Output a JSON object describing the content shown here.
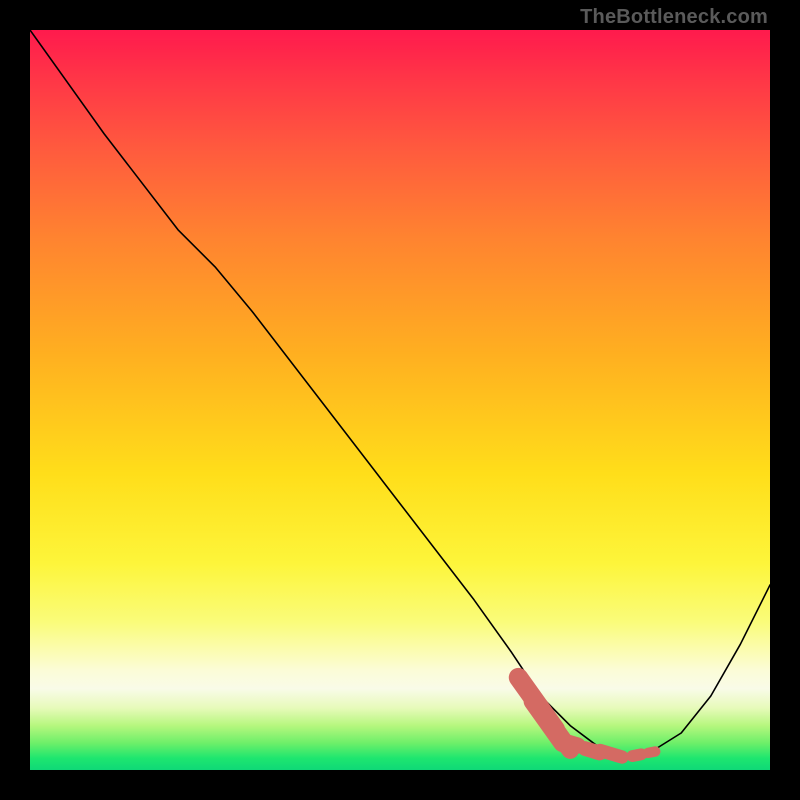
{
  "brand": "TheBottleneck.com",
  "chart_data": {
    "type": "line",
    "title": "",
    "xlabel": "",
    "ylabel": "",
    "xlim": [
      0,
      100
    ],
    "ylim": [
      0,
      100
    ],
    "grid": false,
    "legend": false,
    "series": [
      {
        "name": "bottleneck-curve",
        "x": [
          0,
          10,
          20,
          25,
          30,
          40,
          50,
          60,
          65,
          69,
          73,
          77,
          81,
          84,
          88,
          92,
          96,
          100
        ],
        "y": [
          100,
          86,
          73,
          68,
          62,
          49,
          36,
          23,
          16,
          10,
          6,
          3,
          2,
          2.5,
          5,
          10,
          17,
          25
        ]
      }
    ],
    "markers": {
      "name": "highlight-dashes",
      "points": [
        {
          "x": 68.5,
          "y": 9.0,
          "len": 5.0,
          "w": 2.6
        },
        {
          "x": 70.0,
          "y": 6.5,
          "len": 4.0,
          "w": 2.6
        },
        {
          "x": 71.5,
          "y": 4.8,
          "len": 3.0,
          "w": 2.4
        },
        {
          "x": 73.0,
          "y": 3.6,
          "len": 2.0,
          "w": 2.2
        },
        {
          "x": 76.0,
          "y": 2.6,
          "len": 2.0,
          "w": 2.0
        },
        {
          "x": 78.5,
          "y": 2.2,
          "len": 3.0,
          "w": 1.8
        },
        {
          "x": 82.0,
          "y": 2.0,
          "len": 1.2,
          "w": 1.6
        },
        {
          "x": 84.0,
          "y": 2.4,
          "len": 1.0,
          "w": 1.4
        }
      ],
      "color": "#d46a63"
    },
    "background_gradient": {
      "top": "#ff1a4d",
      "mid": "#ffde1a",
      "bottom": "#0fd877"
    }
  }
}
